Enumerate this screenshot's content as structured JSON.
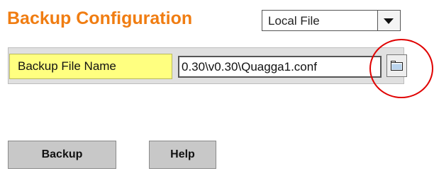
{
  "page": {
    "title": "Backup Configuration",
    "title_color": "#f07d12"
  },
  "backup_type": {
    "selected": "Local File"
  },
  "file_row": {
    "label": "Backup File Name",
    "label_bg": "#ffff80",
    "value": "0.30\\v0.30\\Quagga1.conf",
    "browse_icon": "folder-icon"
  },
  "annotation": {
    "circle_color": "#e00000"
  },
  "buttons": {
    "backup_label": "Backup",
    "help_label": "Help"
  }
}
